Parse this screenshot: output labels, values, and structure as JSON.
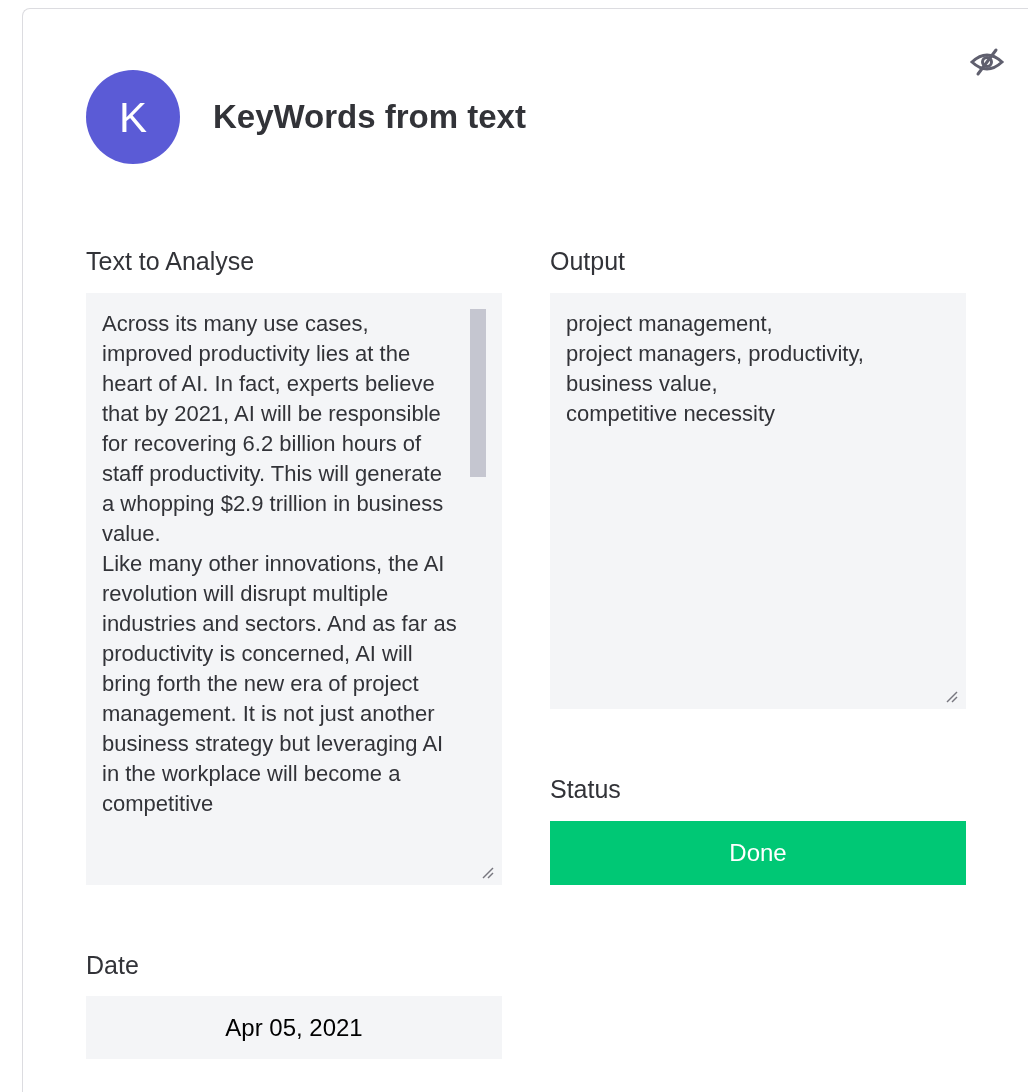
{
  "header": {
    "avatar_letter": "K",
    "title": "KeyWords from text",
    "hidden": true
  },
  "input": {
    "label": "Text to Analyse",
    "value": "Across its many use cases, improved productivity lies at the heart of AI. In fact, experts believe that by 2021, AI will be responsible for recovering 6.2 billion hours of staff productivity. This will generate a whopping $2.9 trillion in business value.\nLike many other innovations, the AI revolution will disrupt multiple industries and sectors. And as far as productivity is concerned, AI will bring forth the new era of project management. It is not just another business strategy but leveraging AI in the workplace will become a competitive"
  },
  "output": {
    "label": "Output",
    "value": "project management,\nproject managers, productivity,\nbusiness value,\ncompetitive necessity"
  },
  "status": {
    "label": "Status",
    "value": "Done"
  },
  "date": {
    "label": "Date",
    "value": "Apr 05, 2021"
  }
}
